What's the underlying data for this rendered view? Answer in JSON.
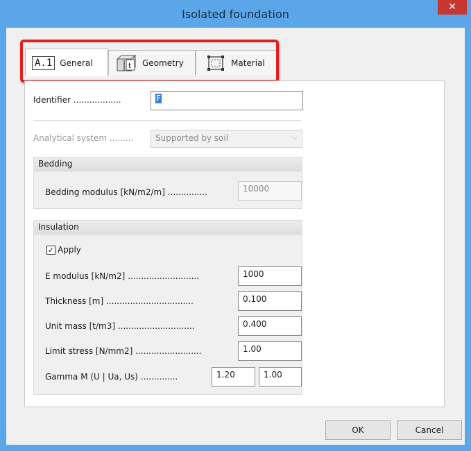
{
  "window": {
    "title": "Isolated foundation",
    "close_glyph": "✕"
  },
  "tabs": [
    {
      "label": "General",
      "icon": "a1-icon",
      "icon_text": "A.1",
      "active": true
    },
    {
      "label": "Geometry",
      "icon": "geometry-icon",
      "active": false
    },
    {
      "label": "Material",
      "icon": "material-icon",
      "active": false
    }
  ],
  "general": {
    "identifier_label": "Identifier ..................",
    "identifier_value": "F",
    "analytical_label": "Analytical system .........",
    "analytical_value": "Supported by soil",
    "bedding": {
      "header": "Bedding",
      "modulus_label": "Bedding modulus [kN/m2/m] ...............",
      "modulus_value": "10000"
    },
    "insulation": {
      "header": "Insulation",
      "apply_label": "Apply",
      "apply_checked": true,
      "e_modulus_label": "E modulus [kN/m2] ...........................",
      "e_modulus_value": "1000",
      "thickness_label": "Thickness [m] .................................",
      "thickness_value": "0.100",
      "unit_mass_label": "Unit mass [t/m3] .............................",
      "unit_mass_value": "0.400",
      "limit_stress_label": "Limit stress [N/mm2] .........................",
      "limit_stress_value": "1.00",
      "gamma_label": "Gamma M (U | Ua, Us) ..............",
      "gamma_u_value": "1.20",
      "gamma_s_value": "1.00"
    }
  },
  "buttons": {
    "ok": "OK",
    "cancel": "Cancel"
  },
  "colors": {
    "highlight": "#e02020",
    "close": "#c7372f",
    "frame": "#5aa6e8"
  }
}
